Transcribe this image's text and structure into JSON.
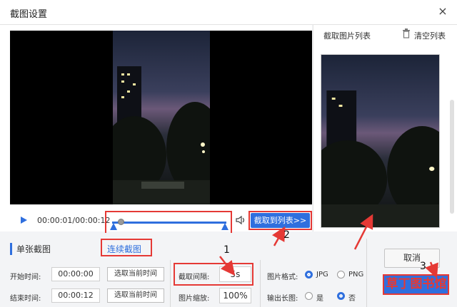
{
  "window": {
    "title": "截图设置",
    "close_label": "×"
  },
  "player": {
    "timecode": "00:00:01/00:00:12",
    "capture_button": "截取到列表>>",
    "progress_fraction": 0.08
  },
  "list": {
    "title": "截取图片列表",
    "clear_label": "清空列表"
  },
  "tabs": {
    "single": "单张截图",
    "continuous": "连续截图"
  },
  "settings": {
    "start_label": "开始时间:",
    "start_value": "00:00:00",
    "start_pick": "选取当前时间",
    "end_label": "结束时间:",
    "end_value": "00:00:12",
    "end_pick": "选取当前时间",
    "interval_label": "截取间隔:",
    "interval_value": "5s",
    "scale_label": "图片缩放:",
    "scale_value": "100%",
    "format_label": "图片格式:",
    "format_jpg": "JPG",
    "format_png": "PNG",
    "long_label": "输出长图:",
    "long_yes": "是",
    "long_no": "否"
  },
  "actions": {
    "cancel": "取消"
  },
  "annotations": {
    "n1": "1",
    "n2": "2",
    "n3": "3",
    "watermark": "草丁图书馆"
  },
  "colors": {
    "accent": "#2f6fde",
    "highlight": "#e53935"
  }
}
